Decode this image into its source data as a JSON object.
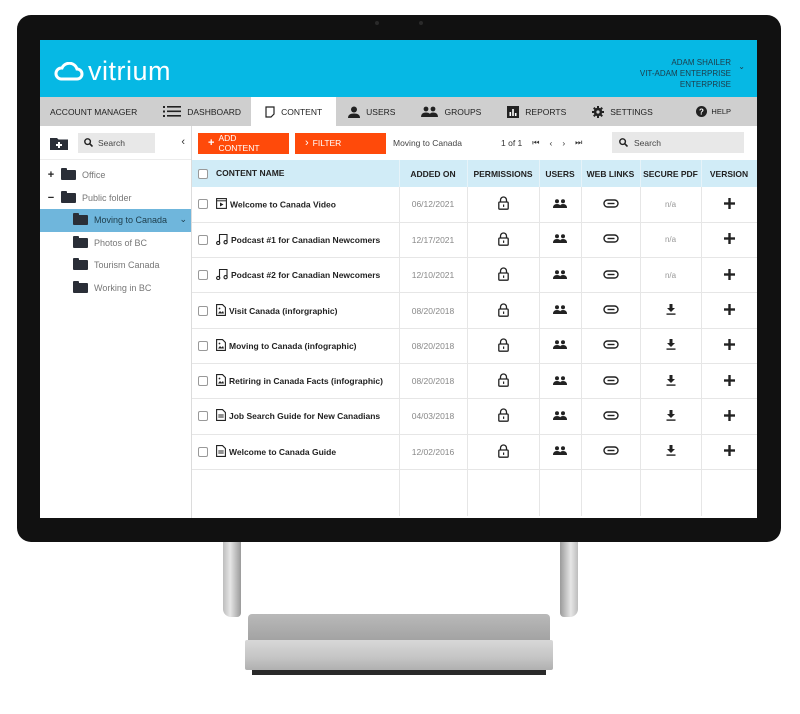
{
  "app": {
    "logo_text": "vitrium",
    "brand_color": "#06b8e4",
    "accent_color": "#ff4a0a",
    "selected_color": "#6fb6dc"
  },
  "user": {
    "name": "ADAM SHAILER",
    "account": "VIT-ADAM ENTERPRISE",
    "plan": "ENTERPRISE"
  },
  "nav": {
    "items": [
      {
        "label": "ACCOUNT MANAGER",
        "icon": "none"
      },
      {
        "label": "DASHBOARD",
        "icon": "list-icon"
      },
      {
        "label": "CONTENT",
        "icon": "document-icon",
        "active": true
      },
      {
        "label": "USERS",
        "icon": "user-icon"
      },
      {
        "label": "GROUPS",
        "icon": "group-icon"
      },
      {
        "label": "REPORTS",
        "icon": "bar-chart-icon"
      },
      {
        "label": "SETTINGS",
        "icon": "gear-icon"
      }
    ],
    "help_label": "HELP"
  },
  "sidebar": {
    "search_placeholder": "Search",
    "tree": [
      {
        "label": "Office",
        "toggle": "+",
        "level": 0
      },
      {
        "label": "Public folder",
        "toggle": "−",
        "level": 0
      },
      {
        "label": "Moving to Canada",
        "level": 1,
        "selected": true
      },
      {
        "label": "Photos of BC",
        "level": 1
      },
      {
        "label": "Tourism Canada",
        "level": 1
      },
      {
        "label": "Working in BC",
        "level": 1
      }
    ]
  },
  "toolbar": {
    "add_content_label": "ADD CONTENT",
    "filter_label": "FILTER",
    "breadcrumb": "Moving to Canada",
    "page_info": "1 of 1",
    "search_placeholder": "Search"
  },
  "table": {
    "columns": [
      "CONTENT NAME",
      "ADDED ON",
      "PERMISSIONS",
      "USERS",
      "WEB LINKS",
      "SECURE PDF",
      "VERSION"
    ],
    "rows": [
      {
        "name": "Welcome to Canada Video",
        "type": "video",
        "added_on": "06/12/2021",
        "secure_pdf": "n/a"
      },
      {
        "name": "Podcast #1 for Canadian Newcomers",
        "type": "audio",
        "added_on": "12/17/2021",
        "secure_pdf": "n/a"
      },
      {
        "name": "Podcast #2 for Canadian Newcomers",
        "type": "audio",
        "added_on": "12/10/2021",
        "secure_pdf": "n/a"
      },
      {
        "name": "Visit Canada (inforgraphic)",
        "type": "image",
        "added_on": "08/20/2018",
        "secure_pdf": "download"
      },
      {
        "name": "Moving to Canada (infographic)",
        "type": "image",
        "added_on": "08/20/2018",
        "secure_pdf": "download"
      },
      {
        "name": "Retiring in Canada Facts (infographic)",
        "type": "image",
        "added_on": "08/20/2018",
        "secure_pdf": "download"
      },
      {
        "name": "Job Search Guide for New Canadians",
        "type": "document",
        "added_on": "04/03/2018",
        "secure_pdf": "download"
      },
      {
        "name": "Welcome to Canada Guide",
        "type": "document",
        "added_on": "12/02/2016",
        "secure_pdf": "download"
      }
    ]
  }
}
